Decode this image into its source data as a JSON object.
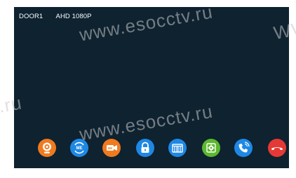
{
  "status": {
    "door": "DOOR1",
    "resolution": "AHD 1080P"
  },
  "watermark": {
    "text_a": "www.esocctv.ru",
    "text_b": "www.esocctv.ru",
    "text_c": ".ru",
    "text_d": "WW"
  },
  "dock": {
    "buttons": [
      {
        "icon": "camera-icon",
        "color": "#f07a1e"
      },
      {
        "icon": "photo-memory-icon",
        "color": "#1e88e5"
      },
      {
        "icon": "video-memory-icon",
        "color": "#f07a1e"
      },
      {
        "icon": "unlock-icon",
        "color": "#1e88e5"
      },
      {
        "icon": "gate-icon",
        "color": "#1e88e5"
      },
      {
        "icon": "settings-icon",
        "color": "#5cb82e"
      },
      {
        "icon": "intercom-call-icon",
        "color": "#1e88e5"
      },
      {
        "icon": "hang-up-icon",
        "color": "#e53935"
      }
    ]
  }
}
